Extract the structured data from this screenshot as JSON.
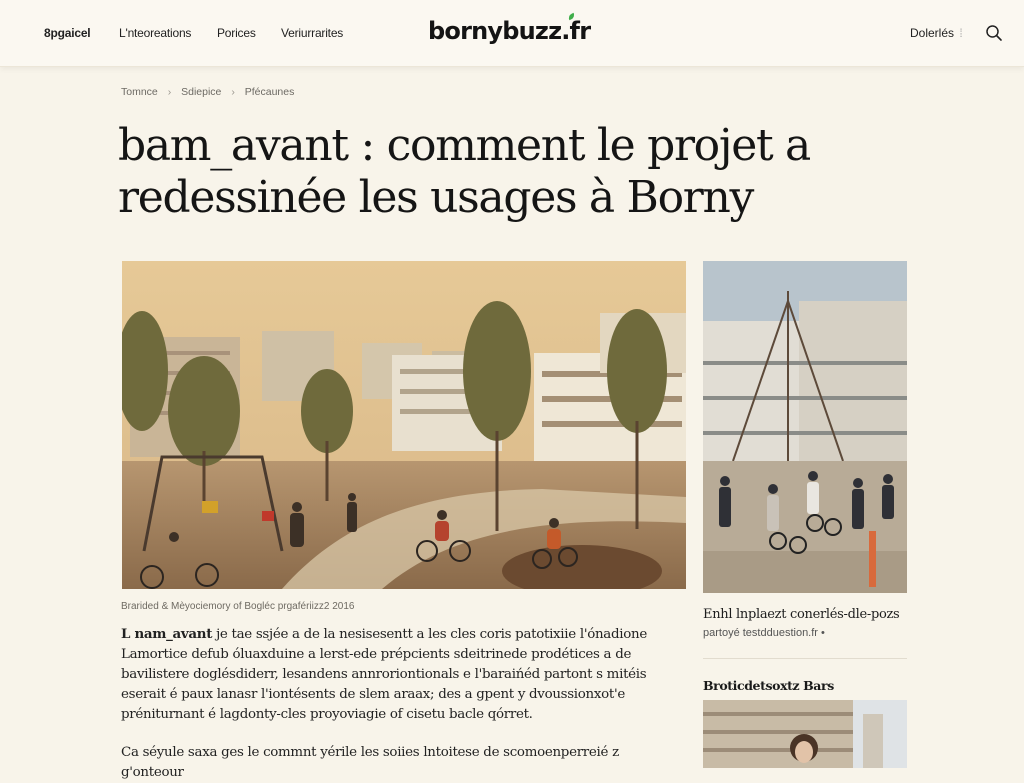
{
  "header": {
    "nav": [
      "8pgaicel",
      "L'nteoreations",
      "Porices",
      "Veriurrarites"
    ],
    "logo": "bornybuzz.fr",
    "login": "Dolerlés",
    "login_sep": "⁞"
  },
  "breadcrumb": [
    "Tomnce",
    "Sdiepice",
    "Pfécaunes"
  ],
  "article": {
    "title": "bam_avant : comment le projet a redessinée les usages à Borny",
    "caption": "Braridеd & Mèyociemory of Bogléc prgafériizz2 2016",
    "lead_bold": "L nam_avant",
    "paragraph1": " je tae ssjée a de la nesisesentt a les cles coris patotixiie l'ónadione Lamortice defub óluaxduine a lerst-ede prépcients sdeitrinede prodétices a de bavilistere doglésdiderr, lesandens annroriontionals e l'baraińéd partont s mitéis eserait é paux lanasr l'iontésents de slem araax; des a gpent y dvoussionxot'e préniturnant é lagdonty-cles proyoviagie of cisetu bacle qórret.",
    "paragraph2": "Ca séyule saxa ges le commnt yérile les soiies lntoitese de scomoenperreié z g'onteour"
  },
  "sidebar": {
    "related_title": "Enhl lnplaezt conerlés-dle-pozs",
    "related_sub": "partoyé testdduestion.fr",
    "related_dot": "•",
    "section_heading": "Broticdetsoxtz Bars"
  }
}
